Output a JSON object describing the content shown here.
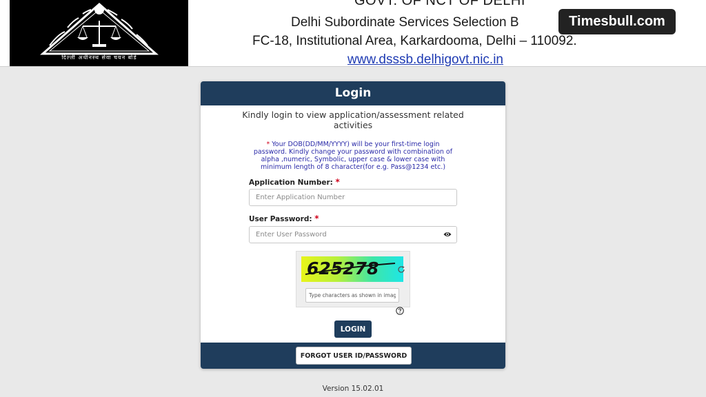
{
  "header": {
    "gov_line": "GOVT. OF NCT OF DELHI",
    "board_line": "Delhi Subordinate Services Selection B",
    "address_line": "FC-18, Institutional Area, Karkardooma, Delhi – 110092.",
    "website": "www.dsssb.delhigovt.nic.in",
    "logo_motto": "दिल्ली अधीनस्थ सेवा चयन बोर्ड"
  },
  "watermark_badge": "Timesbull.com",
  "login": {
    "title": "Login",
    "intro": "Kindly login to view application/assessment related activities",
    "note_star": "*",
    "note": "Your DOB(DD/MM/YYYY) will be your first-time login password. Kindly change your password with combination of alpha ,numeric, Symbolic, upper case & lower case with minimum length of 8 character(for e.g. Pass@1234 etc.)",
    "application_number": {
      "label": "Application Number:",
      "required_mark": "*",
      "value": "",
      "placeholder": "Enter Application Number"
    },
    "user_password": {
      "label": "User Password:",
      "required_mark": "*",
      "value": "",
      "placeholder": "Enter User Password"
    },
    "captcha": {
      "text": "625278",
      "input_value": "",
      "input_placeholder": "Type characters as shown in image"
    },
    "login_button": "LOGIN",
    "forgot_button": "FORGOT USER ID/PASSWORD"
  },
  "version": "Version 15.02.01",
  "colors": {
    "primary_navy": "#1f3d5c",
    "required_red": "#d0021b",
    "note_blue": "#2a2aa8",
    "link_blue": "#1f3bb3",
    "page_background": "#e9e9e9"
  },
  "icons": {
    "password_toggle": "eye-icon",
    "captcha_refresh": "refresh-icon",
    "captcha_help": "question-circle-icon",
    "emblem": "scales-of-justice-icon"
  }
}
